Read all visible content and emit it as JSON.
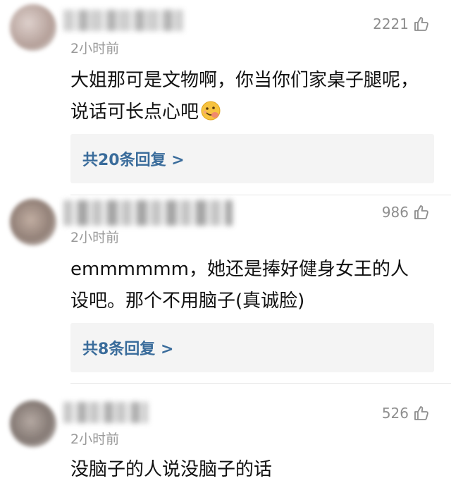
{
  "comments": [
    {
      "time": "2小时前",
      "likes": "2221",
      "text": "大姐那可是文物啊，你当你们家桌子腿呢，说话可长点心吧",
      "replies": "共20条回复 >"
    },
    {
      "time": "2小时前",
      "likes": "986",
      "text": "emmmmmm，她还是捧好健身女王的人设吧。那个不用脑子(真诚脸)",
      "replies": "共8条回复 >"
    },
    {
      "time": "2小时前",
      "likes": "526",
      "text": "没脑子的人说没脑子的话"
    }
  ],
  "icons": {
    "like": "thumbs-up-icon",
    "emoji": "smiling-face-emoji-icon"
  },
  "colors": {
    "reply_link": "#3a6c9b",
    "reply_bg": "#f4f4f4",
    "meta": "#9a9a9a"
  }
}
